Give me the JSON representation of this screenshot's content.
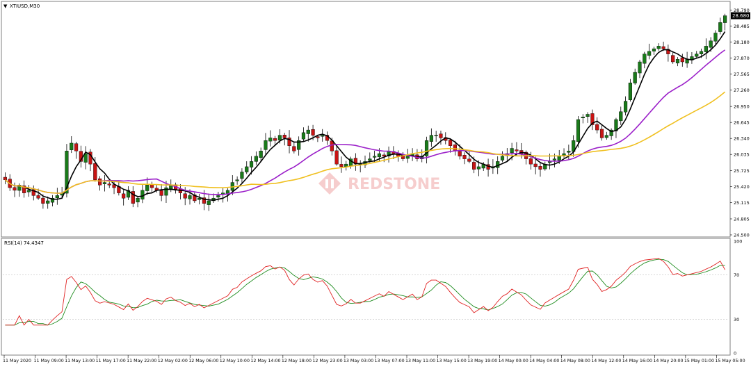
{
  "window": {
    "symbol_label": "XTIUSD,M30",
    "dropdown_glyph": "▼"
  },
  "watermark": {
    "text": "REDSTONE"
  },
  "price_panel": {
    "price_ticks": [
      "28.790",
      "28.485",
      "28.180",
      "27.870",
      "27.565",
      "27.260",
      "26.950",
      "26.645",
      "26.340",
      "26.035",
      "25.725",
      "25.420",
      "25.115",
      "24.805",
      "24.500"
    ],
    "current_price": "28.680",
    "current_price_value": 28.68,
    "ylim": [
      24.5,
      28.9
    ]
  },
  "rsi_panel": {
    "label": "RSI(14) 74.4347",
    "ticks": [
      "100",
      "70",
      "30",
      "0"
    ],
    "levels": [
      70,
      30
    ]
  },
  "x_axis": {
    "labels": [
      "11 May 2020",
      "11 May 09:00",
      "11 May 13:00",
      "11 May 17:00",
      "11 May 22:00",
      "12 May 02:00",
      "12 May 06:00",
      "12 May 10:00",
      "12 May 14:00",
      "12 May 18:00",
      "12 May 23:00",
      "13 May 03:00",
      "13 May 07:00",
      "13 May 11:00",
      "13 May 15:00",
      "13 May 19:00",
      "14 May 00:00",
      "14 May 04:00",
      "14 May 08:00",
      "14 May 12:00",
      "14 May 16:00",
      "14 May 20:00",
      "15 May 01:00",
      "15 May 05:00"
    ]
  },
  "colors": {
    "bull": "#1a7a1a",
    "bear": "#c81414",
    "ma_fast": "#000000",
    "ma_mid": "#9b1fc9",
    "ma_slow": "#f0c020",
    "rsi_line": "#e02020",
    "rsi_signal": "#1e8c1e",
    "price_box": "#000000",
    "watermark": "#f0a6a6"
  },
  "chart_data": {
    "type": "candlestick",
    "series": [
      {
        "name": "price",
        "values": [
          25.55,
          25.4,
          25.35,
          25.45,
          25.3,
          25.35,
          25.25,
          25.2,
          25.1,
          25.15,
          25.2,
          25.25,
          25.3,
          26.1,
          26.25,
          26.1,
          25.9,
          26.05,
          25.85,
          25.55,
          25.45,
          25.5,
          25.45,
          25.4,
          25.3,
          25.2,
          25.35,
          25.1,
          25.2,
          25.35,
          25.45,
          25.4,
          25.35,
          25.25,
          25.4,
          25.45,
          25.35,
          25.3,
          25.2,
          25.25,
          25.15,
          25.2,
          25.1,
          25.15,
          25.2,
          25.25,
          25.3,
          25.35,
          25.5,
          25.55,
          25.7,
          25.8,
          25.9,
          26.0,
          26.1,
          26.3,
          26.35,
          26.3,
          26.4,
          26.35,
          26.2,
          26.1,
          26.3,
          26.45,
          26.5,
          26.4,
          26.35,
          26.4,
          26.3,
          26.1,
          25.85,
          25.8,
          25.85,
          25.95,
          25.85,
          25.85,
          25.9,
          25.95,
          26.0,
          26.05,
          26.0,
          26.1,
          26.05,
          26.0,
          25.95,
          26.0,
          26.05,
          25.95,
          26.0,
          26.3,
          26.4,
          26.4,
          26.35,
          26.3,
          26.2,
          26.1,
          26.0,
          25.95,
          25.9,
          25.75,
          25.8,
          25.85,
          25.75,
          25.8,
          25.9,
          26.0,
          26.05,
          26.15,
          26.1,
          26.05,
          25.95,
          25.85,
          25.8,
          25.75,
          25.85,
          25.9,
          25.95,
          26.0,
          26.05,
          26.1,
          26.3,
          26.7,
          26.75,
          26.8,
          26.6,
          26.5,
          26.35,
          26.4,
          26.5,
          26.7,
          26.85,
          27.05,
          27.4,
          27.6,
          27.8,
          27.95,
          28.0,
          28.05,
          28.1,
          28.05,
          27.95,
          27.8,
          27.85,
          27.8,
          27.85,
          27.9,
          27.95,
          28.0,
          28.1,
          28.2,
          28.35,
          28.55,
          28.68
        ]
      }
    ],
    "overlays": [
      {
        "name": "MA fast",
        "period": 5
      },
      {
        "name": "MA mid",
        "period": 20
      },
      {
        "name": "MA slow",
        "period": 40
      }
    ],
    "indicator": {
      "name": "RSI(14)",
      "last_value": 74.4347,
      "ylim": [
        0,
        100
      ],
      "levels": [
        70,
        30
      ]
    }
  }
}
